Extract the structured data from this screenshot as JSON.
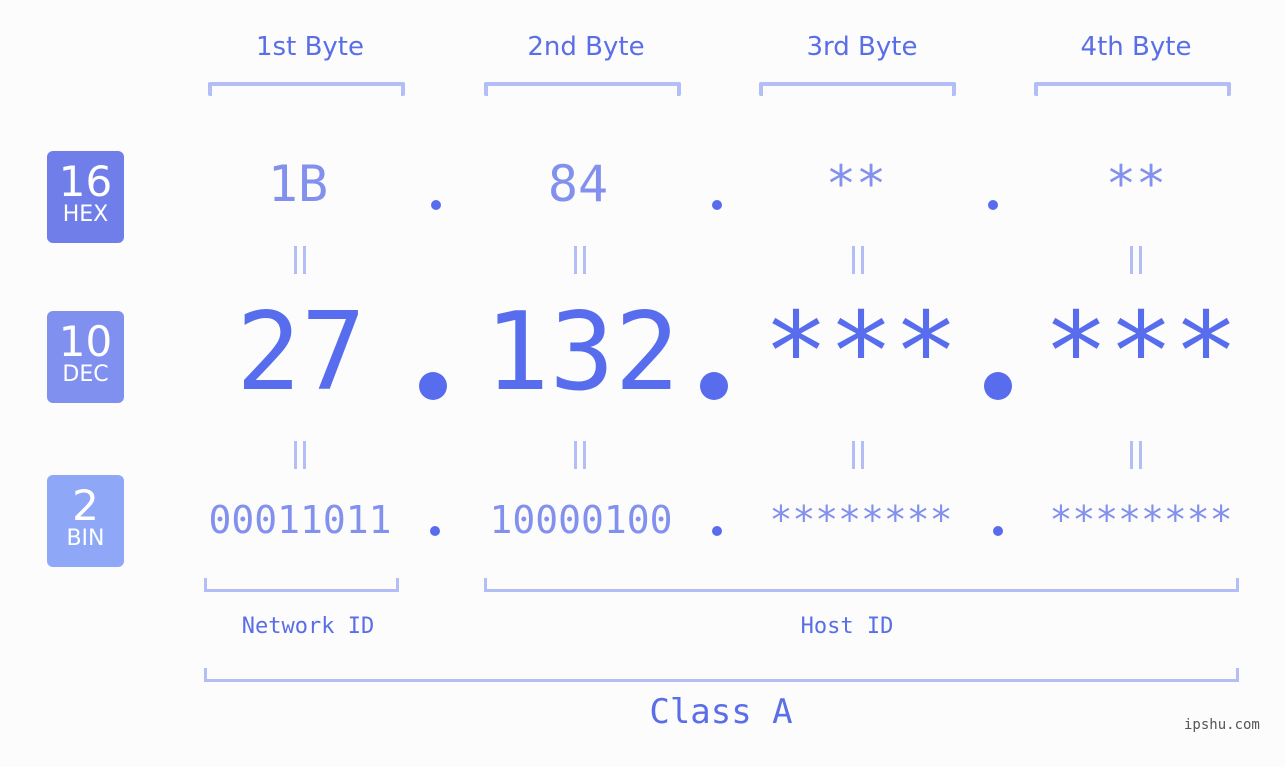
{
  "bytes": {
    "headers": [
      "1st Byte",
      "2nd Byte",
      "3rd Byte",
      "4th Byte"
    ]
  },
  "bases": {
    "hex": {
      "num": "16",
      "label": "HEX",
      "color": "#6f7ee9"
    },
    "dec": {
      "num": "10",
      "label": "DEC",
      "color": "#8090ef"
    },
    "bin": {
      "num": "2",
      "label": "BIN",
      "color": "#8ea7f7"
    }
  },
  "hex_values": [
    "1B",
    "84",
    "**",
    "**"
  ],
  "dec_values": [
    "27",
    "132",
    "***",
    "***"
  ],
  "bin_values": [
    "00011011",
    "10000100",
    "********",
    "********"
  ],
  "separator": ".",
  "equals": "||",
  "labels": {
    "network_id": "Network ID",
    "host_id": "Host ID",
    "class": "Class A"
  },
  "watermark": "ipshu.com",
  "colors": {
    "accent": "#586ded",
    "light_value": "#8290ee",
    "bracket": "#b3bdf6"
  }
}
